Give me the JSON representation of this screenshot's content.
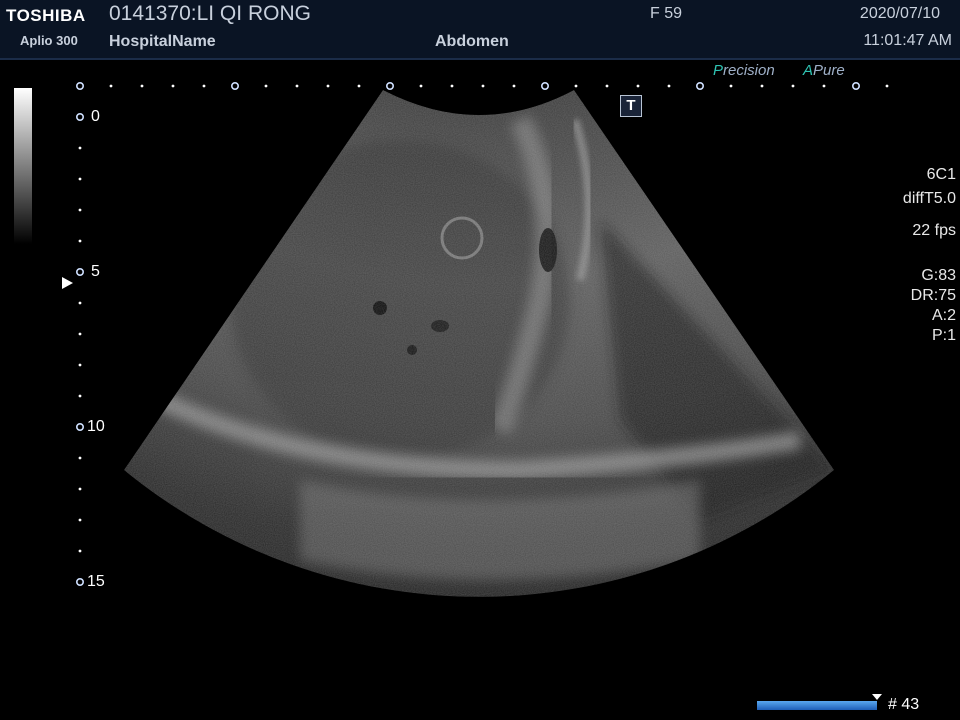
{
  "header": {
    "brand": "TOSHIBA",
    "model": "Aplio 300",
    "patient": "0141370:LI QI RONG",
    "hospital": "HospitalName",
    "sex_age": "F  59",
    "preset": "Abdomen",
    "date": "2020/07/10",
    "time": "11:01:47 AM"
  },
  "features": {
    "precision_initial": "P",
    "precision_rest": "recision",
    "apure_initial": "A",
    "apure_rest": "Pure"
  },
  "params": {
    "probe": "6C1",
    "mode": "diffT5.0",
    "fps": "22 fps",
    "gain": "G:83",
    "dynamic_range": "DR:75",
    "a": "A:2",
    "p": "P:1"
  },
  "depth_scale": {
    "labels": [
      "0",
      "5",
      "10",
      "15"
    ]
  },
  "t_icon": "T",
  "cine": {
    "frame": "# 43"
  },
  "colors": {
    "header_bg": "#0a1424",
    "accent_teal": "#2fc4b4",
    "cine_bar": "#1e5fb8"
  }
}
